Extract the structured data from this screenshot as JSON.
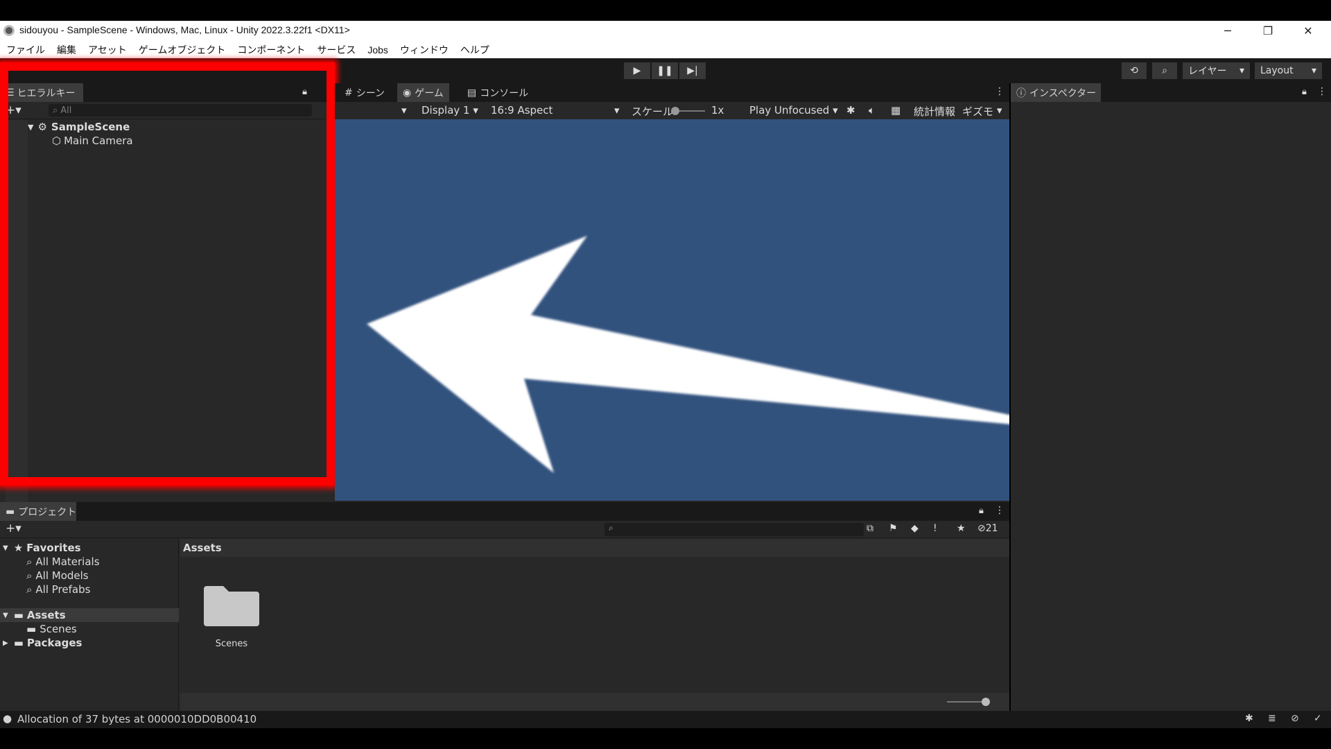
{
  "window": {
    "title": "sidouyou - SampleScene - Windows, Mac, Linux - Unity 2022.3.22f1 <DX11>",
    "minimize": "─",
    "maximize": "❐",
    "close": "✕"
  },
  "menu": [
    "ファイル",
    "編集",
    "アセット",
    "ゲームオブジェクト",
    "コンポーネント",
    "サービス",
    "Jobs",
    "ウィンドウ",
    "ヘルプ"
  ],
  "toolbar": {
    "layer_label": "レイヤー",
    "layout_label": "Layout"
  },
  "hierarchy": {
    "tab": "ヒエラルキー",
    "search_placeholder": "All",
    "scene": "SampleScene",
    "items": [
      "Main Camera"
    ]
  },
  "game_view": {
    "tabs": [
      "シーン",
      "ゲーム",
      "コンソール"
    ],
    "display": "Display 1",
    "aspect": "16:9 Aspect",
    "scale_label": "スケール",
    "scale_value": "1x",
    "play_mode": "Play Unfocused",
    "stats": "統計情報",
    "gizmos": "ギズモ",
    "background_color": "#32527e"
  },
  "inspector": {
    "tab": "インスペクター"
  },
  "project": {
    "tab": "プロジェクト",
    "favorites_label": "Favorites",
    "favorites": [
      "All Materials",
      "All Models",
      "All Prefabs"
    ],
    "assets_label": "Assets",
    "assets_children": [
      "Scenes"
    ],
    "packages_label": "Packages",
    "breadcrumb": "Assets",
    "grid_items": [
      "Scenes"
    ],
    "hidden_count": "21"
  },
  "status": {
    "message": "Allocation of 37 bytes at 0000010DD0B00410"
  },
  "colors": {
    "highlight": "#ff0000",
    "panel": "#282828",
    "game_background": "#32527e"
  }
}
